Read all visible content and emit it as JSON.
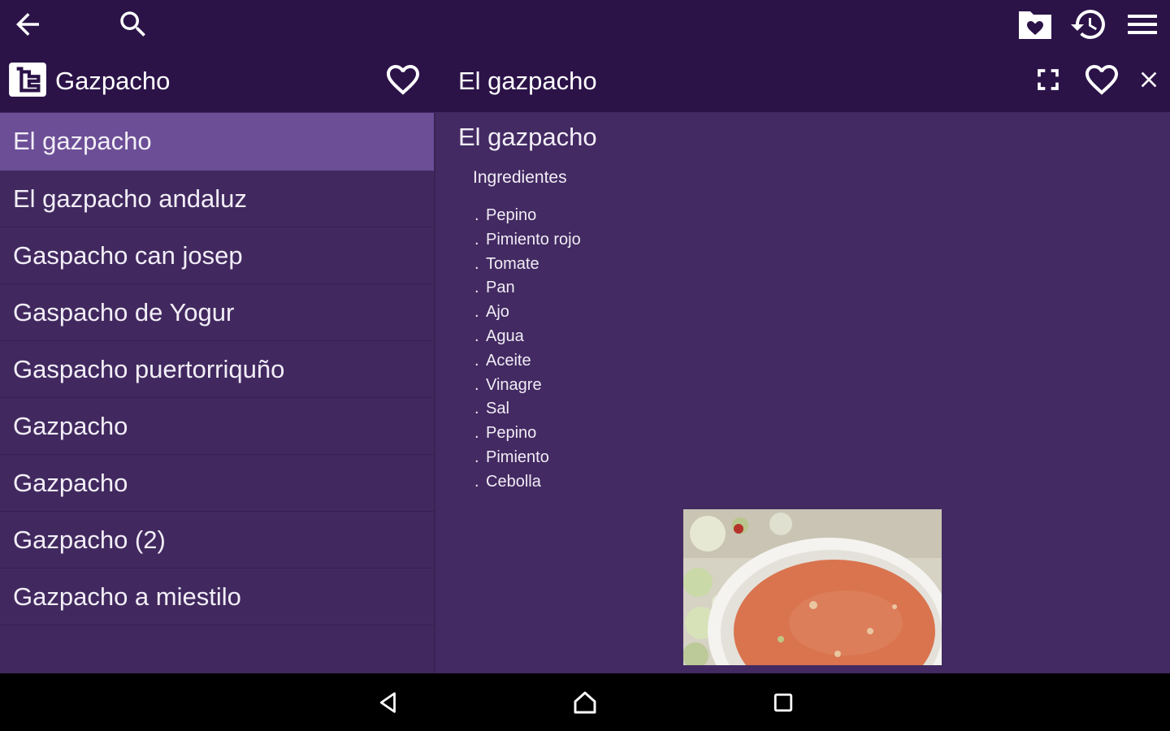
{
  "toolbar": {
    "back_icon": "arrow-back-icon",
    "search_icon": "search-icon",
    "favorites_folder_icon": "favorites-folder-icon",
    "history_icon": "history-icon",
    "menu_icon": "menu-icon"
  },
  "left_panel": {
    "category_icon": "category-tree-icon",
    "title": "Gazpacho",
    "favorite_icon": "heart-outline-icon",
    "items": [
      {
        "label": "El gazpacho",
        "selected": true
      },
      {
        "label": "El gazpacho andaluz",
        "selected": false
      },
      {
        "label": "Gaspacho can josep",
        "selected": false
      },
      {
        "label": "Gaspacho de Yogur",
        "selected": false
      },
      {
        "label": "Gaspacho puertorriquño",
        "selected": false
      },
      {
        "label": "Gazpacho",
        "selected": false
      },
      {
        "label": "Gazpacho",
        "selected": false
      },
      {
        "label": "Gazpacho (2)",
        "selected": false
      },
      {
        "label": "Gazpacho a miestilo",
        "selected": false
      }
    ]
  },
  "right_panel": {
    "title": "El gazpacho",
    "fullscreen_icon": "fullscreen-icon",
    "favorite_icon": "heart-outline-icon",
    "close_icon": "close-icon",
    "heading": "El gazpacho",
    "ingredients_title": "Ingredientes",
    "ingredients": [
      "Pepino",
      "Pimiento rojo",
      "Tomate",
      "Pan",
      "Ajo",
      "Agua",
      "Aceite",
      "Vinagre",
      "Sal",
      "Pepino",
      "Pimiento",
      "Cebolla"
    ],
    "bullet": "."
  },
  "navbar": {
    "back_icon": "nav-back-icon",
    "home_icon": "nav-home-icon",
    "recents_icon": "nav-recents-icon"
  },
  "colors": {
    "toolbar_bg": "#2b1348",
    "panel_bg": "#41295f",
    "selected_bg": "#6b4e96",
    "navbar_bg": "#000000"
  }
}
